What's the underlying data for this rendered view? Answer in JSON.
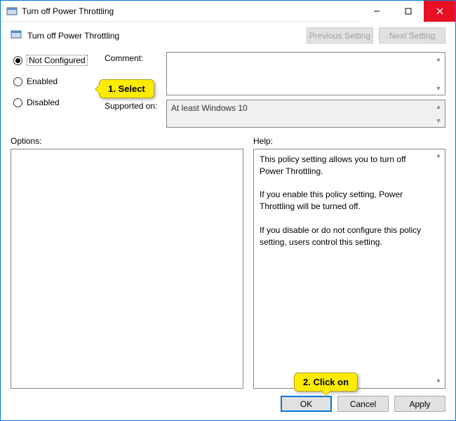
{
  "window": {
    "title": "Turn off Power Throttling"
  },
  "header": {
    "policy_title": "Turn off Power Throttling",
    "prev": "Previous Setting",
    "next": "Next Setting"
  },
  "radios": {
    "not_configured": "Not Configured",
    "enabled": "Enabled",
    "disabled": "Disabled",
    "selected": "not_configured"
  },
  "fields": {
    "comment_label": "Comment:",
    "comment_value": "",
    "supported_label": "Supported on:",
    "supported_value": "At least Windows 10"
  },
  "labels": {
    "options": "Options:",
    "help": "Help:"
  },
  "help": {
    "p1": "This policy setting allows you to turn off Power Throttling.",
    "p2": "If you enable this policy setting, Power Throttling will be turned off.",
    "p3": "If you disable or do not configure this policy setting, users control this setting."
  },
  "buttons": {
    "ok": "OK",
    "cancel": "Cancel",
    "apply": "Apply"
  },
  "annotations": {
    "select": "1. Select",
    "click": "2. Click on"
  }
}
